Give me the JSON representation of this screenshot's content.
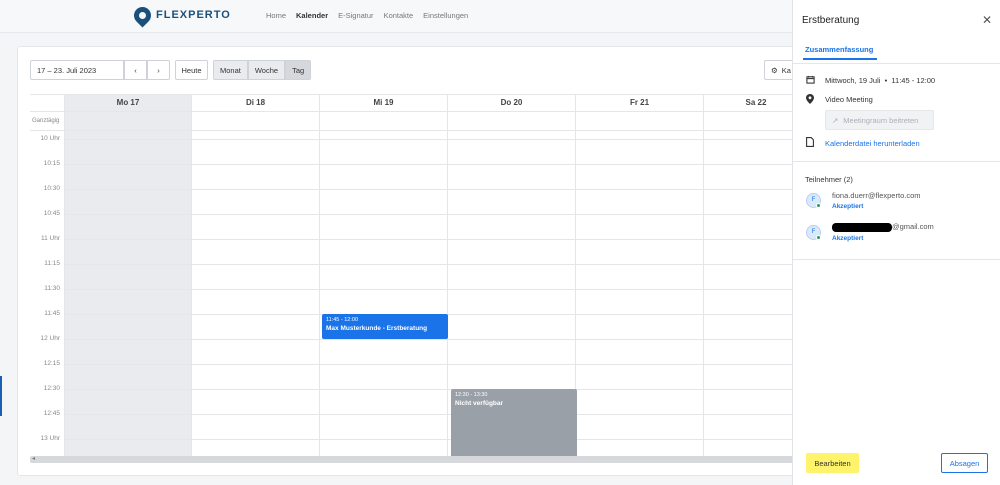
{
  "app": {
    "logo_text": "FLEXPERTO"
  },
  "nav": {
    "items": [
      "Home",
      "Kalender",
      "E-Signatur",
      "Kontakte",
      "Einstellungen"
    ],
    "active": "Kalender"
  },
  "toolbar": {
    "date_range": "17 – 23. Juli 2023",
    "today": "Heute",
    "views": [
      "Monat",
      "Woche",
      "Tag"
    ],
    "calendar_button": "Ka"
  },
  "calendar": {
    "allday_label": "Ganztägig",
    "days": [
      "Mo 17",
      "Di 18",
      "Mi 19",
      "Do 20",
      "Fr 21",
      "Sa 22"
    ],
    "times": [
      "10 Uhr",
      "10:15",
      "10:30",
      "10:45",
      "11 Uhr",
      "11:15",
      "11:30",
      "11:45",
      "12 Uhr",
      "12:15",
      "12:30",
      "12:45",
      "13 Uhr"
    ],
    "events": [
      {
        "time": "11:45 - 12:00",
        "title": "Max Musterkunde - Erstberatung",
        "color": "#1a73e8"
      },
      {
        "time": "12:30 - 13:30",
        "title": "Nicht verfügbar",
        "color": "#9aa0a8"
      }
    ]
  },
  "panel": {
    "title": "Erstberatung",
    "tab": "Zusammenfassung",
    "date": "Mittwoch, 19 Juli",
    "time": "11:45 - 12:00",
    "location": "Video Meeting",
    "meeting_button": "Meetingraum beitreten",
    "download_link": "Kalenderdatei herunterladen",
    "participants_header": "Teilnehmer (2)",
    "participants": [
      {
        "initial": "F",
        "email": "fiona.duerr@flexperto.com",
        "status": "Akzeptiert"
      },
      {
        "initial": "F",
        "email_suffix": "@gmail.com",
        "status": "Akzeptiert"
      }
    ],
    "edit_button": "Bearbeiten",
    "cancel_button": "Absagen"
  }
}
